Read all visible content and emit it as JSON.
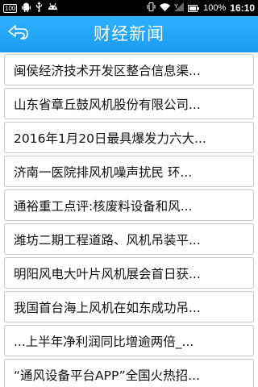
{
  "status_bar": {
    "badge": "100",
    "left_icons": [
      "android-icon",
      "usb-icon",
      "android-debug-icon"
    ],
    "right_icons": [
      "vibrate-icon",
      "wifi-icon",
      "no-signal-icon",
      "battery-icon"
    ],
    "battery_percent": "100%",
    "time": "16:10"
  },
  "header": {
    "title": "财经新闻",
    "back_icon": "back-arrow-icon",
    "background": "#1fa2f4"
  },
  "news": [
    "闽侯经济技术开发区整合信息渠...",
    "山东省章丘鼓风机股份有限公司...",
    "2016年1月20日最具爆发力六大...",
    "济南一医院排风机噪声扰民 环...",
    "通裕重工点评:核废料设备和风...",
    "潍坊二期工程道路、风机吊装平...",
    "明阳风电大叶片风机展会首日获...",
    "我国首台海上风机在如东成功吊...",
    "...上半年净利润同比增逾两倍_...",
    "“通风设备平台APP”全国火热招..."
  ]
}
